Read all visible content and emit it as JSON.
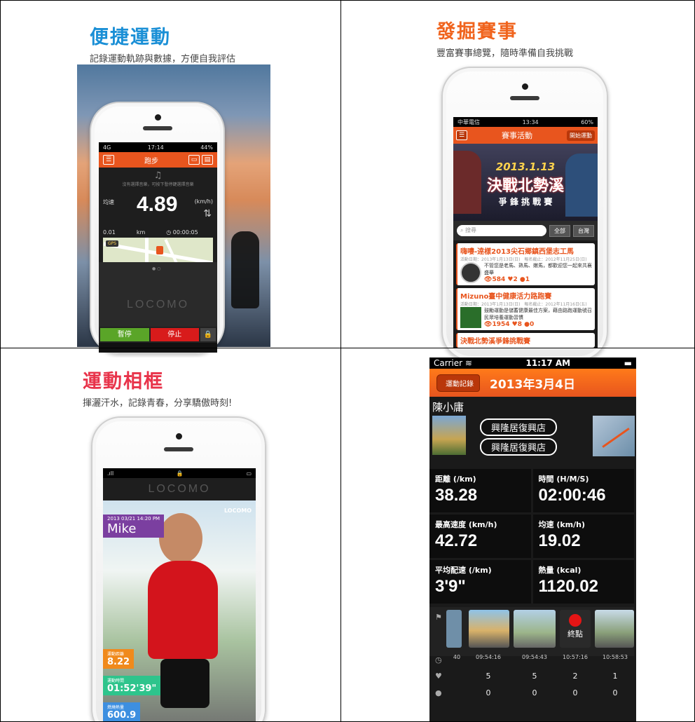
{
  "panel1": {
    "title": "便捷運動",
    "subtitle": "記錄運動軌跡與數據，方便自我評估",
    "title_color": "#1a8fd6",
    "screen": {
      "status_carrier": "4G",
      "status_time": "17:14",
      "status_batt": "44%",
      "header": "跑步",
      "music_note": "♫",
      "music_hint": "沒有選擇音樂，可按下暫停鍵選擇音樂",
      "speed_label": "均速",
      "speed": "4.89",
      "speed_unit": "(km/h)",
      "distance": "0.01",
      "distance_unit": "km",
      "time": "00:00:05",
      "gps": "GPS",
      "brand": "LOCOMO",
      "pause": "暫停",
      "stop": "停止"
    }
  },
  "panel2": {
    "title": "發掘賽事",
    "subtitle": "豐富賽事總覽，隨時準備自我挑戰",
    "title_color": "#f0641e",
    "screen": {
      "status_carrier": "中華電信",
      "status_time": "13:34",
      "status_batt": "60%",
      "header": "賽事活動",
      "start_btn": "開始運動",
      "banner_date": "2013.1.13",
      "banner_title": "決戰北勢溪",
      "banner_sub": "爭 鋒 挑 戰 賽",
      "search_placeholder": "搜尋",
      "seg_all": "全部",
      "seg_tw": "台灣",
      "events": [
        {
          "title": "嗨嘍-逹樣2013尖石鄉鎮西堡志工馬",
          "meta": "活動日期：2013年1月13日(日)　報名截止：2012年11月25日(日)",
          "desc": "不管您是老馬、熟馬、嫩馬，都歡迎您一起來共襄盛舉",
          "views": "584",
          "likes": "2",
          "comments": "1"
        },
        {
          "title": "Mizuno臺中健康活力路跑賽",
          "meta": "活動日期：2013年1月13日(日)　報名截止：2012年11月16日(五)",
          "desc": "鼓勵運動是儲蓄健康最佳方案，藉由路跑運動號召民眾培養運動習慣",
          "views": "1954",
          "likes": "8",
          "comments": "0"
        },
        {
          "title": "決戰北勢溪爭鋒挑戰賽"
        }
      ]
    }
  },
  "panel3": {
    "title": "運動相框",
    "subtitle": "揮灑汗水，記錄青春，分享驕傲時刻!",
    "title_color": "#e8334a",
    "screen": {
      "brand": "LOCOMO",
      "corner_logo": "LOCOMO",
      "datetime": "2013 03/21 14:20 PM",
      "name": "Mike",
      "stat1_label": "運動距離",
      "stat1_value": "8.22",
      "stat2_label": "運動時間",
      "stat2_value": "01:52'39\"",
      "stat3_label": "燃燒熱量",
      "stat3_value": "600.9"
    }
  },
  "panel4": {
    "status_carrier": "Carrier",
    "status_time": "11:17 AM",
    "back_label": "運動記錄",
    "nav_title": "2013年3月4日",
    "user_name": "陳小庸",
    "pill1": "興隆居復興店",
    "pill2": "興隆居復興店",
    "stats": [
      {
        "label": "距離 (/km)",
        "value": "38.28"
      },
      {
        "label": "時間 (H/M/S)",
        "value": "02:00:46"
      },
      {
        "label": "最高速度 (km/h)",
        "value": "42.72"
      },
      {
        "label": "均速 (km/h)",
        "value": "19.02"
      },
      {
        "label": "平均配速 (/km)",
        "value": "3'9\""
      },
      {
        "label": "熱量 (kcal)",
        "value": "1120.02"
      }
    ],
    "endpoint_label": "終點",
    "times": [
      "40",
      "09:54:16",
      "09:54:43",
      "10:57:16",
      "10:58:53"
    ],
    "likes": [
      "5",
      "5",
      "2",
      "1"
    ],
    "comments": [
      "0",
      "0",
      "0",
      "0"
    ]
  }
}
